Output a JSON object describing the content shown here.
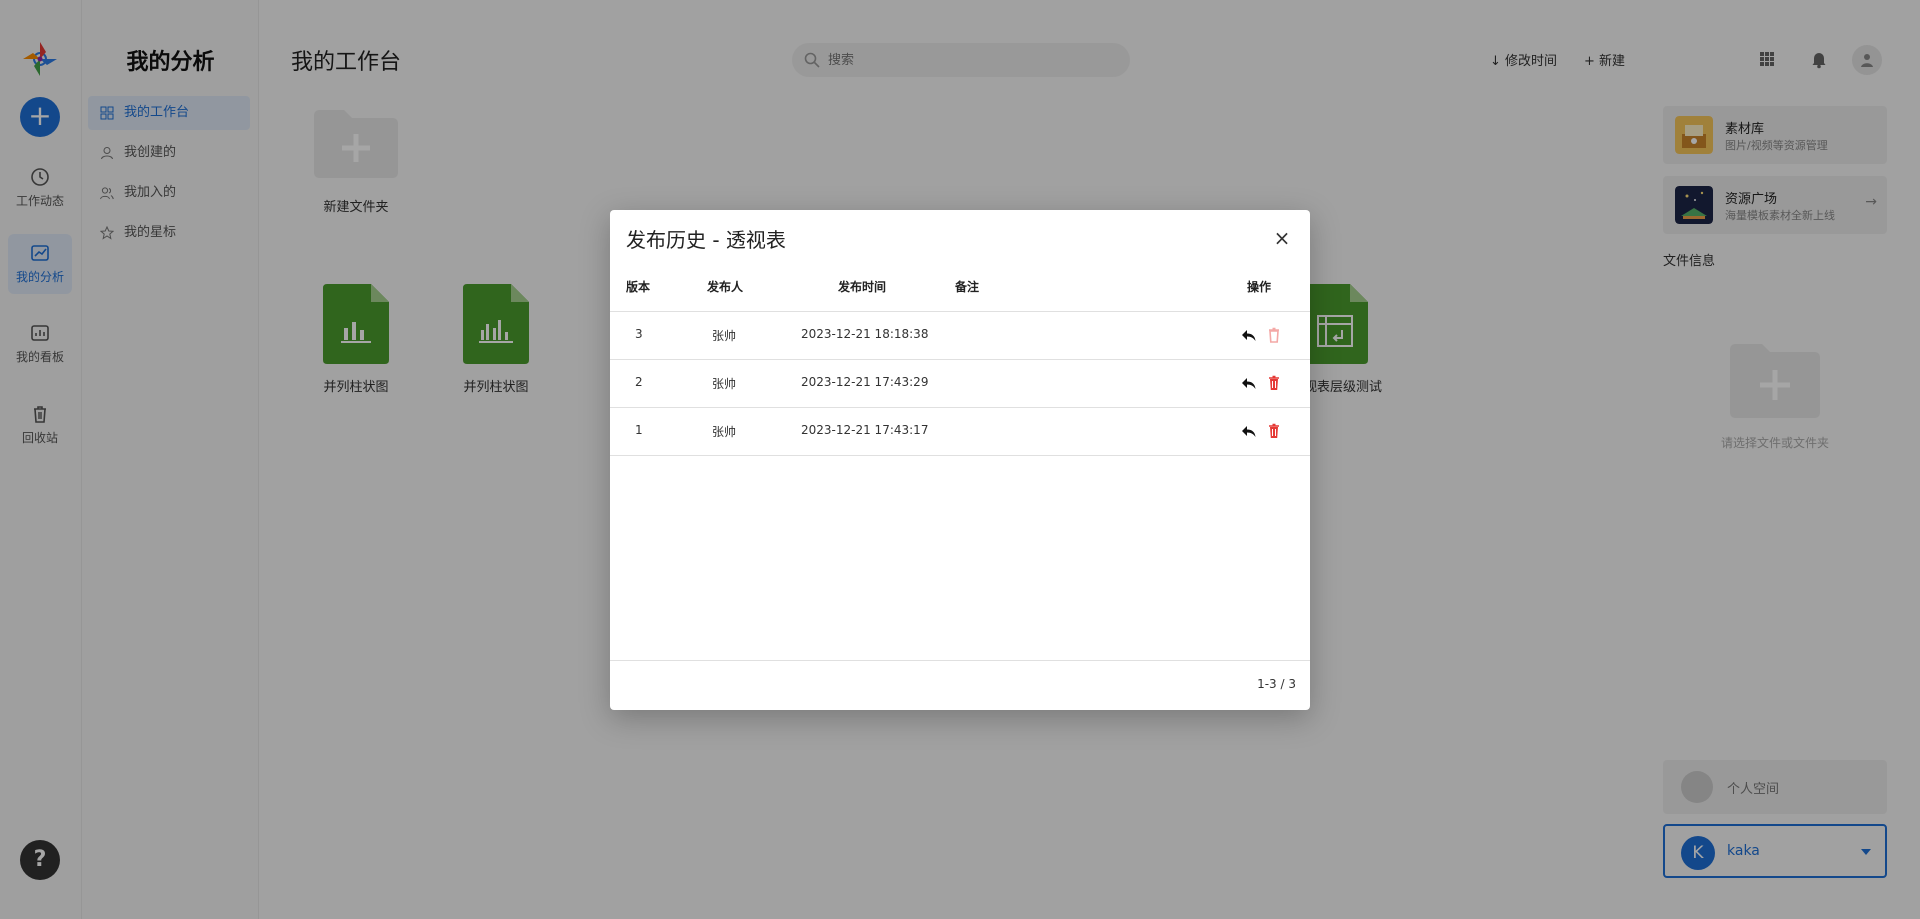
{
  "rail": {
    "items": [
      {
        "label": "工作动态",
        "icon": "clock-icon"
      },
      {
        "label": "我的分析",
        "icon": "analysis-icon"
      },
      {
        "label": "我的看板",
        "icon": "dashboard-icon"
      },
      {
        "label": "回收站",
        "icon": "trash-icon"
      }
    ],
    "add_icon": "+",
    "help_icon": "?"
  },
  "sidebar": {
    "title": "我的分析",
    "items": [
      {
        "label": "我的工作台"
      },
      {
        "label": "我创建的"
      },
      {
        "label": "我加入的"
      },
      {
        "label": "我的星标"
      }
    ]
  },
  "header": {
    "title": "我的工作台",
    "search_placeholder": "搜索",
    "sort_label": "修改时间",
    "new_label": "新建"
  },
  "workspace": {
    "folder_label": "新建文件夹",
    "files": [
      {
        "label": "并列柱状图"
      },
      {
        "label": "并列柱状图"
      },
      {
        "label": "视表层级测试"
      }
    ]
  },
  "right_panel": {
    "cards": [
      {
        "title": "素材库",
        "subtitle": "图片/视频等资源管理"
      },
      {
        "title": "资源广场",
        "subtitle": "海量模板素材全新上线"
      }
    ],
    "file_info": "文件信息",
    "empty_text": "请选择文件或文件夹",
    "personal_space": "个人空间",
    "user": {
      "initial": "K",
      "name": "kaka"
    }
  },
  "modal": {
    "title": "发布历史 - 透视表",
    "columns": {
      "version": "版本",
      "publisher": "发布人",
      "time": "发布时间",
      "note": "备注",
      "actions": "操作"
    },
    "rows": [
      {
        "version": "3",
        "publisher": "张帅",
        "time": "2023-12-21 18:18:38",
        "note": ""
      },
      {
        "version": "2",
        "publisher": "张帅",
        "time": "2023-12-21 17:43:29",
        "note": ""
      },
      {
        "version": "1",
        "publisher": "张帅",
        "time": "2023-12-21 17:43:17",
        "note": ""
      }
    ],
    "pager": "1-3 / 3"
  },
  "colors": {
    "accent": "#1e6fd6",
    "file_green": "#4a9c2d",
    "danger": "#e53935"
  }
}
